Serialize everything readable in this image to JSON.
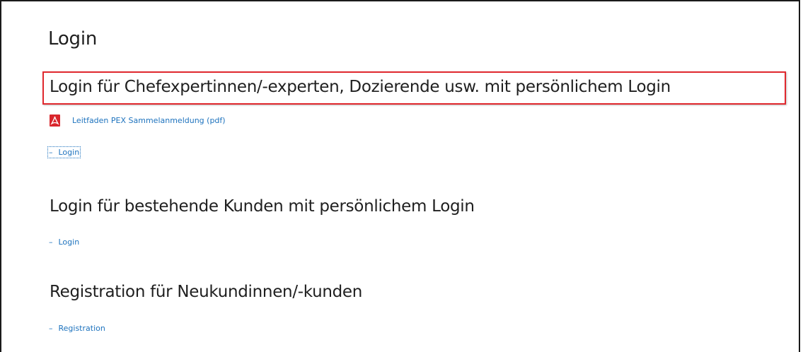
{
  "page": {
    "title": "Login"
  },
  "sections": [
    {
      "heading": "Login für Chefexpertinnen/-experten, Dozierende usw. mit persönlichem Login",
      "document_link": {
        "icon": "pdf-icon",
        "label": "Leitfaden PEX Sammelanmeldung (pdf)"
      },
      "link": {
        "dash": "–",
        "label": "Login"
      }
    },
    {
      "heading": "Login für bestehende Kunden mit persönlichem Login",
      "link": {
        "dash": "–",
        "label": "Login"
      }
    },
    {
      "heading": "Registration für Neukundinnen/-kunden",
      "link": {
        "dash": "–",
        "label": "Registration"
      }
    }
  ],
  "colors": {
    "link": "#1e73be",
    "highlight_border": "#e0282e",
    "pdf_icon": "#d9262c",
    "text": "#1f1f1f"
  }
}
